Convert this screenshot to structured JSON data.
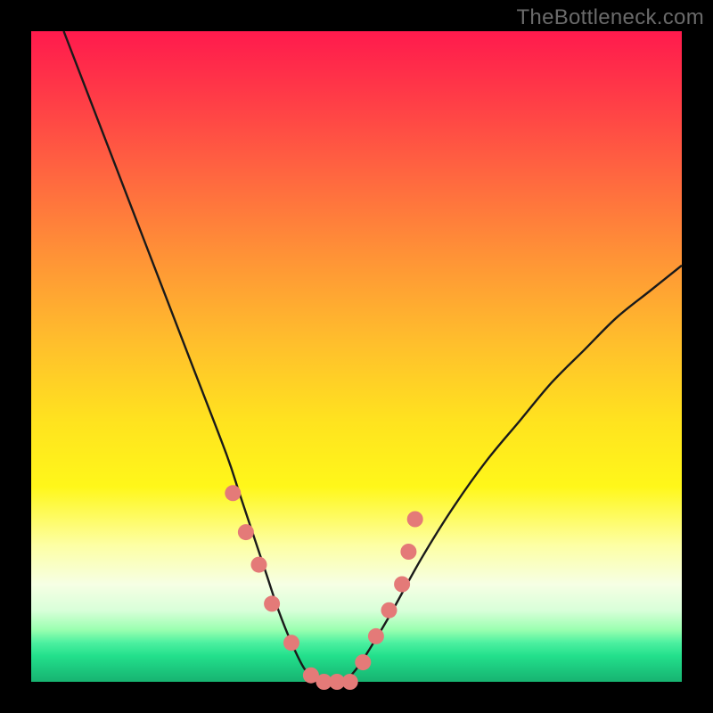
{
  "watermark": "TheBottleneck.com",
  "colors": {
    "background": "#000000",
    "curve_stroke": "#1a1a1a",
    "dot_fill": "#e47a78",
    "gradient_top": "#ff1a4d",
    "gradient_mid": "#ffe31f",
    "gradient_bottom": "#17b371"
  },
  "chart_data": {
    "type": "line",
    "title": "",
    "xlabel": "",
    "ylabel": "",
    "xlim": [
      0,
      100
    ],
    "ylim": [
      0,
      100
    ],
    "grid": false,
    "series": [
      {
        "name": "bottleneck-curve",
        "x": [
          5,
          10,
          15,
          20,
          25,
          30,
          32,
          34,
          36,
          38,
          40,
          42,
          44,
          46,
          48,
          50,
          52,
          55,
          60,
          65,
          70,
          75,
          80,
          85,
          90,
          95,
          100
        ],
        "y": [
          100,
          87,
          74,
          61,
          48,
          35,
          29,
          23,
          17,
          11,
          6,
          2,
          0,
          0,
          0,
          2,
          5,
          10,
          19,
          27,
          34,
          40,
          46,
          51,
          56,
          60,
          64
        ]
      }
    ],
    "annotations": [
      {
        "name": "highlight-dots",
        "x": [
          31,
          33,
          35,
          37,
          40,
          43,
          45,
          47,
          49,
          51,
          53,
          55,
          57,
          58,
          59
        ],
        "y": [
          29,
          23,
          18,
          12,
          6,
          1,
          0,
          0,
          0,
          3,
          7,
          11,
          15,
          20,
          25
        ]
      }
    ]
  }
}
